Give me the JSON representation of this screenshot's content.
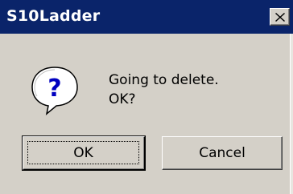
{
  "window": {
    "title": "S10Ladder",
    "close_icon": "close-icon",
    "titlebar_color": "#0a246a"
  },
  "message": {
    "icon": "question-bubble-icon",
    "line1": "Going to delete.",
    "line2": "OK?"
  },
  "buttons": {
    "ok_label": "OK",
    "cancel_label": "Cancel"
  }
}
